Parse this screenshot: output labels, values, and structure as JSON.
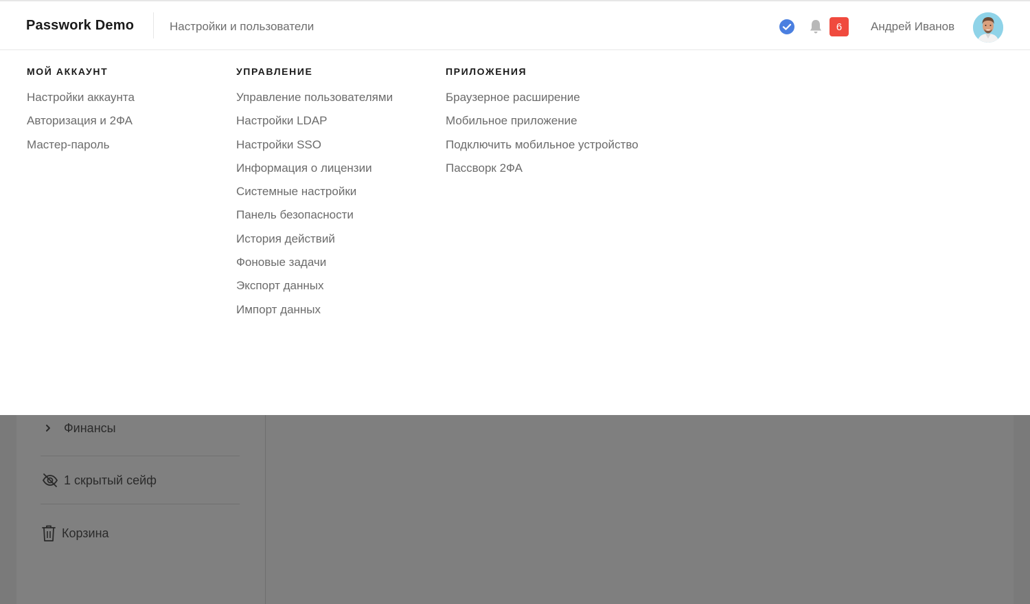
{
  "header": {
    "brand": "Passwork Demo",
    "breadcrumb": "Настройки и пользователи",
    "notification_count": "6",
    "user_name": "Андрей Иванов",
    "icons": {
      "verified": "check-circle-icon",
      "notifications": "bell-icon",
      "avatar": "user-avatar"
    },
    "colors": {
      "verified": "#4a7fe0",
      "badge": "#f04a3e"
    }
  },
  "menu": {
    "columns": [
      {
        "heading": "МОЙ АККАУНТ",
        "items": [
          "Настройки аккаунта",
          "Авторизация и 2ФА",
          "Мастер-пароль"
        ]
      },
      {
        "heading": "УПРАВЛЕНИЕ",
        "items": [
          "Управление пользователями",
          "Настройки LDAP",
          "Настройки SSO",
          "Информация о лицензии",
          "Системные настройки",
          "Панель безопасности",
          "История действий",
          "Фоновые задачи",
          "Экспорт данных",
          "Импорт данных"
        ]
      },
      {
        "heading": "ПРИЛОЖЕНИЯ",
        "items": [
          "Браузерное расширение",
          "Мобильное приложение",
          "Подключить мобильное устройство",
          "Пассворк 2ФА"
        ]
      }
    ]
  },
  "sidebar": {
    "folder_item": "Финансы",
    "hidden_vaults": "1 скрытый сейф",
    "trash": "Корзина",
    "icons": {
      "folder_toggle": "chevron-right-icon",
      "hidden": "eye-slash-icon",
      "trash": "trash-icon"
    }
  }
}
